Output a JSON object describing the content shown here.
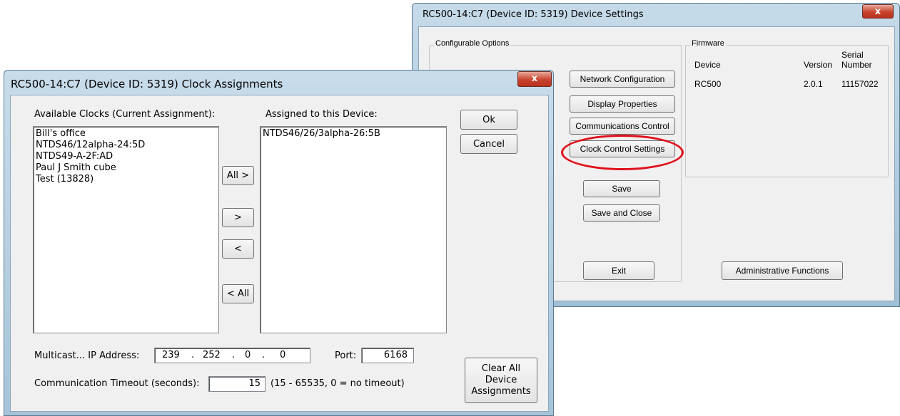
{
  "device_settings": {
    "title": "RC500-14:C7 (Device ID: 5319) Device Settings",
    "close_label": "x",
    "configurable_options_label": "Configurable Options",
    "buttons": {
      "network_configuration": "Network Configuration",
      "display_properties": "Display Properties",
      "communications_control": "Communications Control",
      "clock_control_settings": "Clock Control Settings",
      "save": "Save",
      "save_and_close": "Save and Close",
      "exit": "Exit",
      "administrative_functions": "Administrative Functions"
    },
    "firmware": {
      "label": "Firmware",
      "col_device": "Device",
      "col_version": "Version",
      "col_serial_1": "Serial",
      "col_serial_2": "Number",
      "rows": [
        {
          "device": "RC500",
          "version": "2.0.1",
          "serial": "11157022"
        }
      ]
    },
    "highlight_color": "#e0101a"
  },
  "clock_assignments": {
    "title": "RC500-14:C7 (Device ID: 5319) Clock Assignments",
    "close_label": "x",
    "available_label": "Available Clocks (Current Assignment):",
    "assigned_label": "Assigned to this Device:",
    "available_clocks": [
      "Bill's office",
      "NTDS46/12alpha-24:5D",
      "NTDS49-A-2F:AD",
      "Paul J Smith cube",
      "Test (13828)"
    ],
    "assigned_clocks": [
      "NTDS46/26/3alpha-26:5B"
    ],
    "buttons": {
      "ok": "Ok",
      "cancel": "Cancel",
      "all_right": "All >",
      "right": ">",
      "left": "<",
      "all_left": "< All",
      "clear_1": "Clear All",
      "clear_2": "Device",
      "clear_3": "Assignments"
    },
    "multicast_label": "Multicast...  IP Address:",
    "ip": [
      "239",
      "252",
      "0",
      "0"
    ],
    "ip_sep": ".",
    "port_label": "Port:",
    "port_value": "6168",
    "timeout_label": "Communication Timeout (seconds):",
    "timeout_value": "15",
    "timeout_hint": "(15 - 65535, 0 = no timeout)"
  }
}
